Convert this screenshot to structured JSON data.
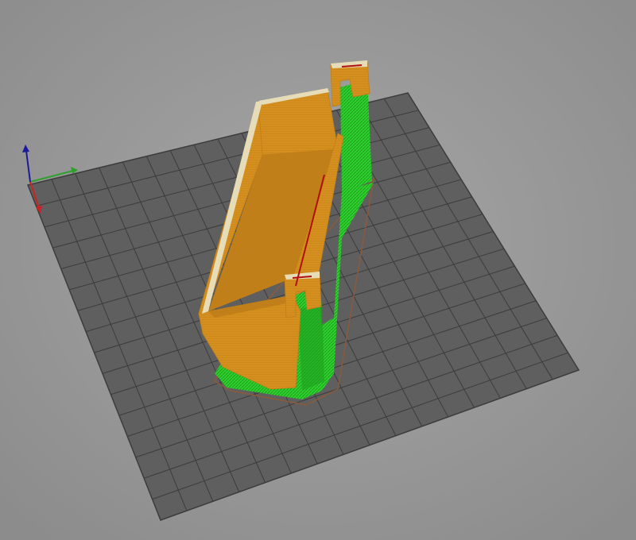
{
  "app": {
    "view": "3d-print-preview",
    "background_color": "#9a9a9a"
  },
  "scene": {
    "bed": {
      "fill_color": "#5f5f5f",
      "grid_color": "#3c3c3c",
      "grid_divisions": 16
    },
    "model": {
      "description": "sliced-part-with-supports",
      "perimeter_color": "#d48f1f",
      "perimeter_shade_color": "#c07f18",
      "infill_highlight_color": "#e6ddb8",
      "support_color": "#2ed12e",
      "support_dark_color": "#1e9e1e",
      "skirt_color": "#8b5a3c",
      "seam_color": "#b01010"
    },
    "axes": {
      "x_color": "#2ea02e",
      "y_color": "#cc2222",
      "z_color": "#1b1b9a"
    }
  }
}
